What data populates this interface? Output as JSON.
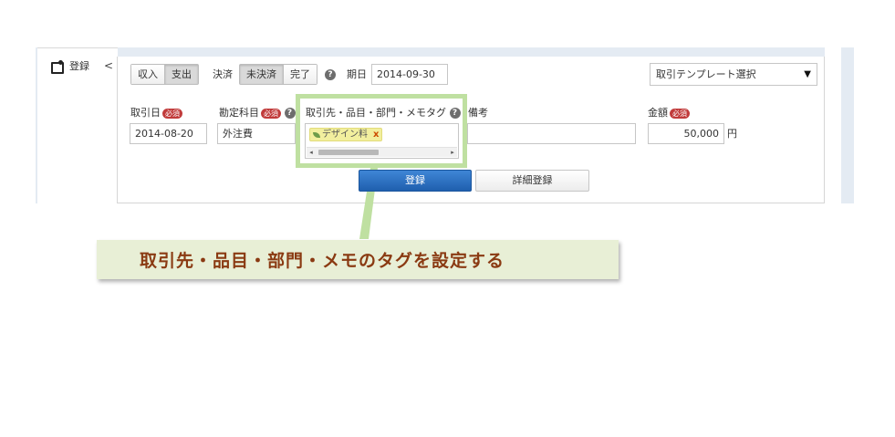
{
  "side": {
    "label": "登録",
    "collapse": "<"
  },
  "toolbar": {
    "type_income": "収入",
    "type_expense": "支出",
    "settle_label": "決済",
    "settle_unsettled": "未決済",
    "settle_done": "完了",
    "due_label": "期日",
    "due_value": "2014-09-30",
    "template_placeholder": "取引テンプレート選択",
    "template_arrow": "▼"
  },
  "form": {
    "required_badge": "必須",
    "help_icon": "?",
    "date_label": "取引日",
    "date_value": "2014-08-20",
    "account_label": "勘定科目",
    "account_value": "外注費",
    "tags_label": "取引先・品目・部門・メモタグ",
    "tag_value": "デザイン料",
    "tag_remove": "x",
    "scroll_left": "◂",
    "scroll_right": "▸",
    "memo_label": "備考",
    "memo_value": "",
    "amount_label": "金額",
    "amount_value": "50,000",
    "currency": "円"
  },
  "actions": {
    "register": "登録",
    "detail_register": "詳細登録"
  },
  "callout": {
    "text": "取引先・品目・部門・メモのタグを設定する"
  },
  "colors": {
    "highlight_green": "#bfe0a1",
    "callout_bg": "#e8efd6",
    "callout_text": "#8a3a12",
    "primary_button": "#2a6fc2",
    "required_badge": "#c13b3b",
    "tag_bg": "#f2ef9e"
  },
  "icons": {
    "side": "register-icon",
    "help": "help-icon",
    "tag": "leaf-icon",
    "remove": "close-icon",
    "select": "caret-down-icon"
  }
}
